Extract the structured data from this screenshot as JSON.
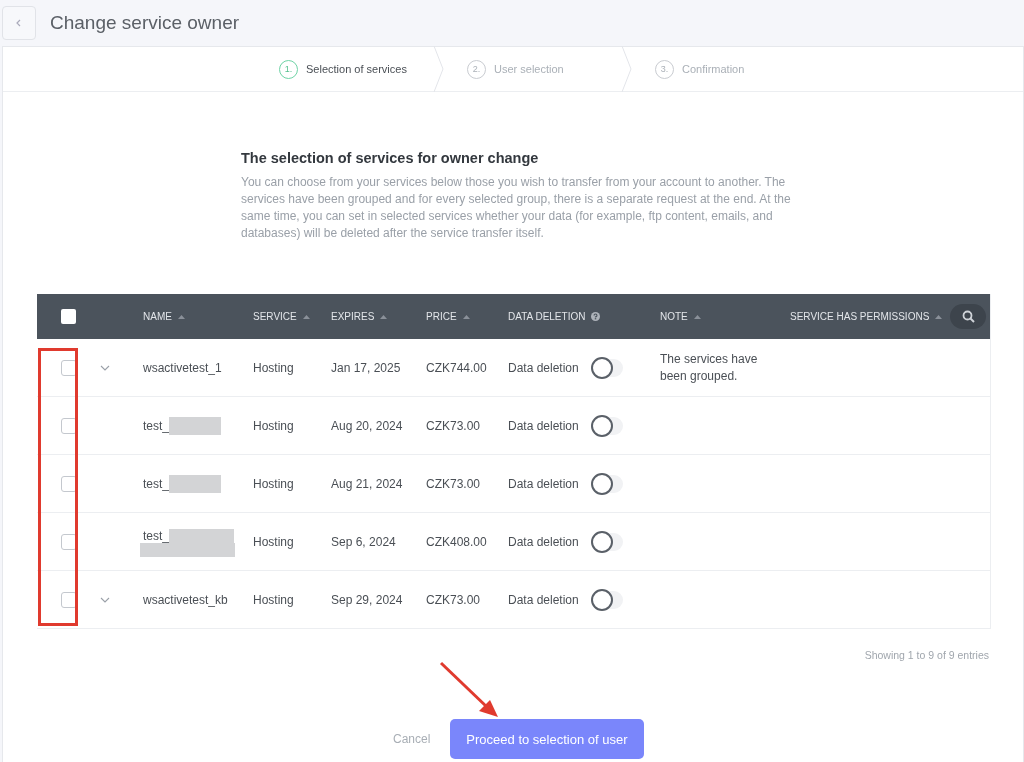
{
  "page": {
    "title": "Change service owner"
  },
  "steps": [
    {
      "number": "1.",
      "label": "Selection of services",
      "selected": true
    },
    {
      "number": "2.",
      "label": "User selection",
      "selected": false
    },
    {
      "number": "3.",
      "label": "Confirmation",
      "selected": false
    }
  ],
  "section": {
    "heading": "The selection of services for owner change",
    "description": "You can choose from your services below those you wish to transfer from your account to another. The services have been grouped and for every selected group, there is a separate request at the end. At the same time, you can set in selected services whether your data (for example, ftp content, emails, and databases) will be deleted after the service transfer itself."
  },
  "table": {
    "select_all": {
      "checked": false
    },
    "columns": [
      {
        "label": "NAME",
        "kind": "sort"
      },
      {
        "label": "SERVICE",
        "kind": "sort"
      },
      {
        "label": "EXPIRES",
        "kind": "sort"
      },
      {
        "label": "PRICE",
        "kind": "sort"
      },
      {
        "label": "DATA DELETION",
        "kind": "help"
      },
      {
        "label": "NOTE",
        "kind": "sort"
      },
      {
        "label": "SERVICE HAS PERMISSIONS",
        "kind": "sort"
      }
    ],
    "rows": [
      {
        "checked": false,
        "expandable": true,
        "name": "wsactivetest_1",
        "kind": "plain",
        "service": "Hosting",
        "expires": "Jan 17, 2025",
        "price": "CZK744.00",
        "deletion_label": "Data deletion",
        "deletion_on": false,
        "note": "The services have been grouped."
      },
      {
        "checked": false,
        "expandable": false,
        "name": "test_",
        "kind": "redacted",
        "service": "Hosting",
        "expires": "Aug 20, 2024",
        "price": "CZK73.00",
        "deletion_label": "Data deletion",
        "deletion_on": false
      },
      {
        "checked": false,
        "expandable": false,
        "name": "test_",
        "kind": "redacted",
        "service": "Hosting",
        "expires": "Aug 21, 2024",
        "price": "CZK73.00",
        "deletion_label": "Data deletion",
        "deletion_on": false
      },
      {
        "checked": false,
        "expandable": false,
        "name": "test_",
        "kind": "redacted2",
        "service": "Hosting",
        "expires": "Sep 6, 2024",
        "price": "CZK408.00",
        "deletion_label": "Data deletion",
        "deletion_on": false
      },
      {
        "checked": false,
        "expandable": true,
        "name": "wsactivetest_kb",
        "kind": "plain",
        "service": "Hosting",
        "expires": "Sep 29, 2024",
        "price": "CZK73.00",
        "deletion_label": "Data deletion",
        "deletion_on": false
      }
    ],
    "footer": "Showing 1 to 9 of 9 entries"
  },
  "actions": {
    "cancel": "Cancel",
    "proceed": "Proceed to selection of user"
  }
}
